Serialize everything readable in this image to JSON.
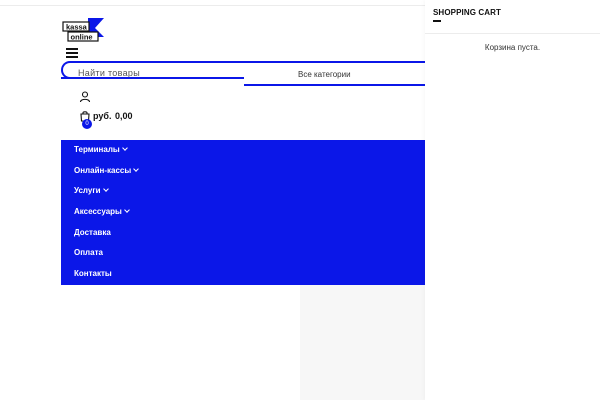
{
  "header": {
    "logo": {
      "line1": "kassa",
      "line2": "online"
    },
    "menu_icon": "hamburger-icon",
    "search": {
      "placeholder": "Найти товары",
      "category_label": "Все категории"
    },
    "user_icon": "user-icon",
    "cart": {
      "icon": "shopping-bag-icon",
      "count": "0",
      "currency": "руб.",
      "total": "0,00"
    }
  },
  "nav": {
    "items": [
      {
        "label": "Терминалы",
        "has_dropdown": true
      },
      {
        "label": "Онлайн-кассы",
        "has_dropdown": true
      },
      {
        "label": "Услуги",
        "has_dropdown": true
      },
      {
        "label": "Аксессуары",
        "has_dropdown": true
      },
      {
        "label": "Доставка",
        "has_dropdown": false
      },
      {
        "label": "Оплата",
        "has_dropdown": false
      },
      {
        "label": "Контакты",
        "has_dropdown": false
      }
    ]
  },
  "side_cart": {
    "title": "SHOPPING CART",
    "empty_text": "Корзина пуста."
  },
  "colors": {
    "accent": "#0b17e8",
    "text": "#111111",
    "background": "#ffffff"
  }
}
